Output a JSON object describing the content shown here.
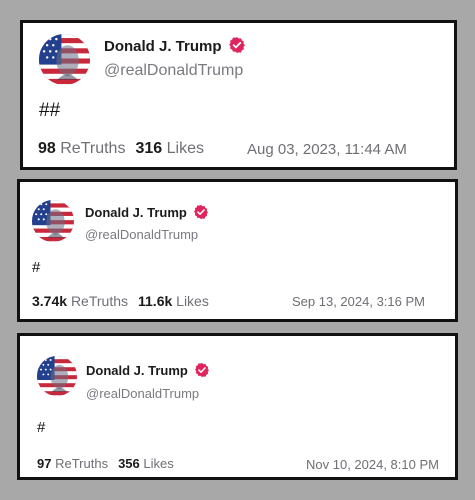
{
  "posts": [
    {
      "author_name": "Donald J. Trump",
      "handle": "@realDonaldTrump",
      "content": "##",
      "retruths_count": "98",
      "retruths_label": "ReTruths",
      "likes_count": "316",
      "likes_label": "Likes",
      "timestamp": "Aug 03, 2023, 11:44 AM"
    },
    {
      "author_name": "Donald J. Trump",
      "handle": "@realDonaldTrump",
      "content": "#",
      "retruths_count": "3.74k",
      "retruths_label": "ReTruths",
      "likes_count": "11.6k",
      "likes_label": "Likes",
      "timestamp": "Sep 13, 2024, 3:16 PM"
    },
    {
      "author_name": "Donald J. Trump",
      "handle": "@realDonaldTrump",
      "content": "#",
      "retruths_count": "97",
      "retruths_label": "ReTruths",
      "likes_count": "356",
      "likes_label": "Likes",
      "timestamp": "Nov 10, 2024, 8:10 PM"
    }
  ],
  "icons": {
    "verified": "verified-badge-icon",
    "avatar": "flag-portrait-avatar"
  },
  "colors": {
    "verified_badge": "#e0245e",
    "page_background": "#a8a8a8",
    "card_border": "#111111"
  }
}
